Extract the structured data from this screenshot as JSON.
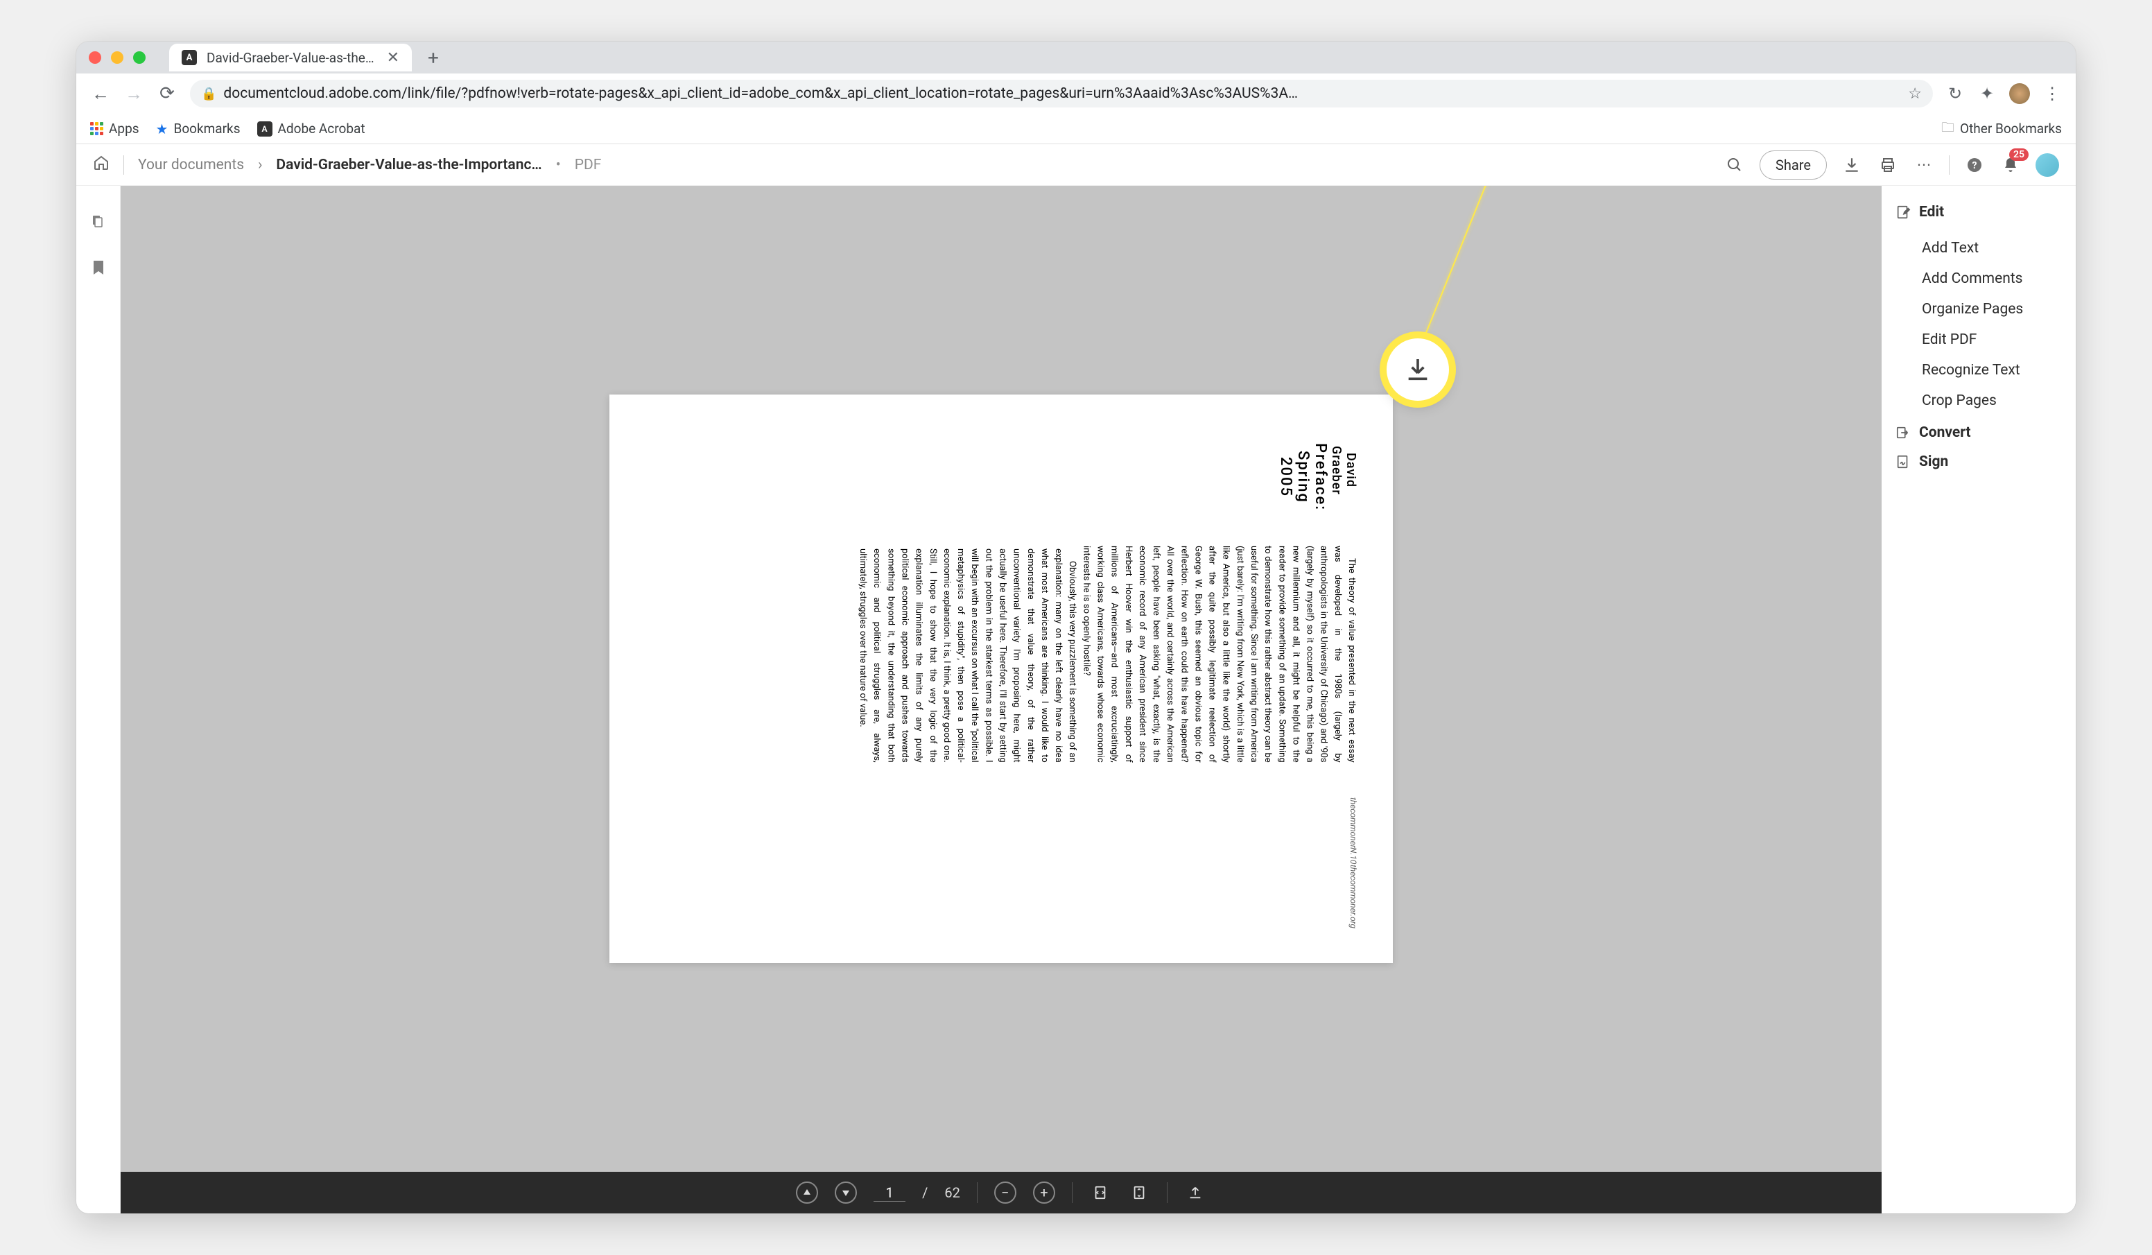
{
  "browser": {
    "tab_title": "David-Graeber-Value-as-the-I…",
    "url": "documentcloud.adobe.com/link/file/?pdfnow!verb=rotate-pages&x_api_client_id=adobe_com&x_api_client_location=rotate_pages&uri=urn%3Aaaid%3Asc%3AUS%3A…",
    "bookmarks_bar": {
      "apps": "Apps",
      "bookmarks": "Bookmarks",
      "acrobat": "Adobe Acrobat",
      "other": "Other Bookmarks"
    }
  },
  "app": {
    "header": {
      "crumb_root": "Your documents",
      "filename": "David-Graeber-Value-as-the-Importanc…",
      "filetype_sep": "•",
      "filetype": "PDF",
      "share_label": "Share",
      "notif_count": "25"
    },
    "page_controls": {
      "current_page": "1",
      "page_sep": "/",
      "total_pages": "62"
    },
    "right_panel": {
      "edit_header": "Edit",
      "items": [
        "Add Text",
        "Add Comments",
        "Organize Pages",
        "Edit PDF",
        "Recognize Text",
        "Crop Pages"
      ],
      "convert_header": "Convert",
      "sign_header": "Sign"
    }
  },
  "document": {
    "author": "David Graeber",
    "preface": "Preface: Spring 2005",
    "para1": "The theory of value presented in the next essay was developed in the 1980s (largely by anthropologists in the University of Chicago) and '90s (largely by myself) so it occurred to me, this being a new millennium and all, it might be helpful to the reader to provide something of an update. Something to demonstrate how this rather abstract theory can be useful for something. Since I am writing from America (just barely: I'm writing from New York, which is a little like America, but also a little like the world) shortly after the quite possibly legitimate reelection of George W. Bush, this seemed an obvious topic for reflection. How on earth could this have happened? All over the world, and certainly across the American left, people have been asking \"what, exactly, is the economic record of any American president since Herbert Hoover win the enthusiastic support of millions of Americans—and most excruciatingly, working class Americans, towards whose economic interests he is so openly hostile?",
    "para2": "Obviously, this very puzzlement is something of an explanation: many on the left clearly have no idea what most Americans are thinking. I would like to demonstrate that value theory, of the rather unconventional variety I'm proposing here, might actually be useful here. Therefore, I'll start by setting out the problem in the starkest terms as possible. I will begin with an excursus on what I call the \"political metaphysics of stupidity\", then pose a political-economic explanation. It is, I think, a pretty good one. Still, I hope to show that the very logic of the explanation illuminates the limits of any purely political economic approach and pushes towards something beyond it, the understanding that both economic and political struggles are, always, ultimately, struggles over the nature of value.",
    "footer_left": "thecommoner",
    "footer_mid": "N.10",
    "footer_right": "thecommoner.org"
  }
}
